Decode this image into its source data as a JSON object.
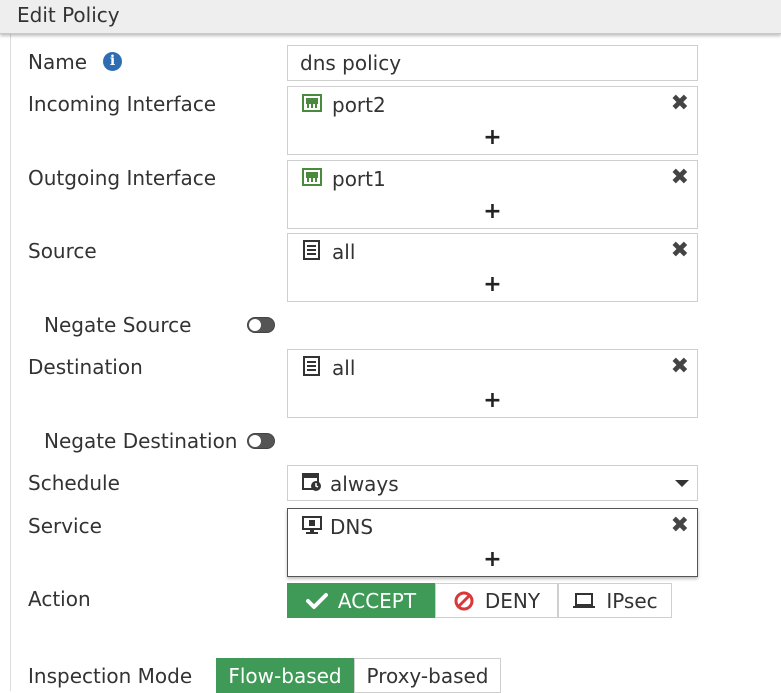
{
  "header": {
    "title": "Edit Policy"
  },
  "form": {
    "name": {
      "label": "Name",
      "value": "dns policy"
    },
    "incoming": {
      "label": "Incoming Interface",
      "entry": "port2",
      "icon": "network-port-icon"
    },
    "outgoing": {
      "label": "Outgoing Interface",
      "entry": "port1",
      "icon": "network-port-icon"
    },
    "source": {
      "label": "Source",
      "entry": "all",
      "icon": "address-book-icon"
    },
    "negate_source": {
      "label": "Negate Source",
      "enabled": false
    },
    "destination": {
      "label": "Destination",
      "entry": "all",
      "icon": "address-book-icon"
    },
    "negate_destination": {
      "label": "Negate Destination",
      "enabled": false
    },
    "schedule": {
      "label": "Schedule",
      "value": "always",
      "icon": "calendar-clock-icon"
    },
    "service": {
      "label": "Service",
      "entry": "DNS",
      "icon": "service-monitor-icon"
    },
    "action": {
      "label": "Action",
      "options": [
        {
          "label": "ACCEPT",
          "icon": "check-icon"
        },
        {
          "label": "DENY",
          "icon": "deny-icon"
        },
        {
          "label": "IPsec",
          "icon": "laptop-icon"
        }
      ],
      "selected": "ACCEPT"
    },
    "inspection": {
      "label": "Inspection Mode",
      "options": [
        {
          "label": "Flow-based"
        },
        {
          "label": "Proxy-based"
        }
      ],
      "selected": "Flow-based"
    }
  },
  "symbols": {
    "remove": "✖",
    "add": "+"
  },
  "colors": {
    "accent_green": "#3f9a57",
    "info_blue": "#2f6db3",
    "deny_red": "#d9383a",
    "port_green": "#4a8a3c"
  }
}
